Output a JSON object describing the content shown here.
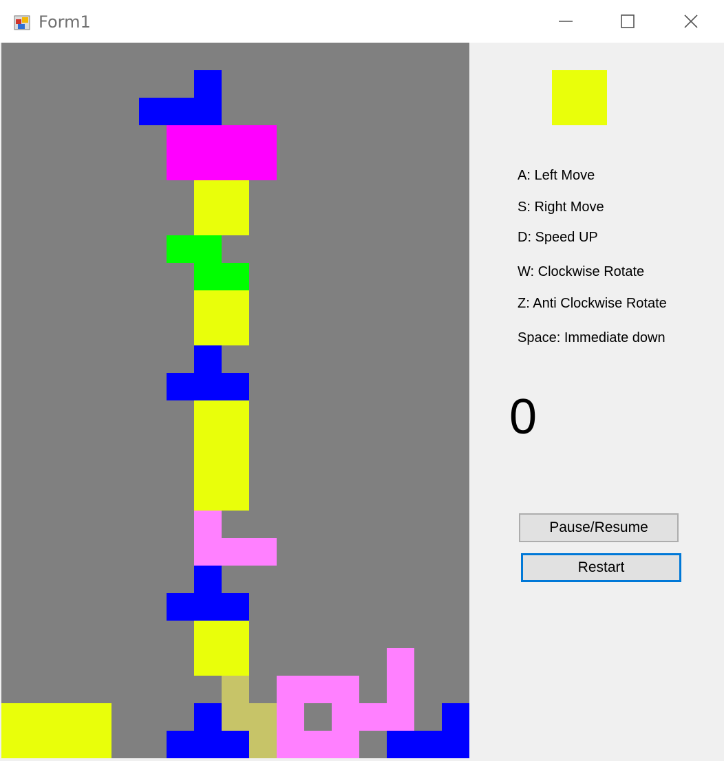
{
  "window": {
    "title": "Form1"
  },
  "colors": {
    "board_background": "#808080",
    "yellow": "#e9ff0a",
    "blue": "#0000ff",
    "magenta": "#ff00ff",
    "green": "#00ff00",
    "pink": "#ff80ff",
    "khaki": "#c7c468"
  },
  "board": {
    "columns": 17,
    "rows": 26,
    "cells": [
      {
        "col": 7,
        "row": 1,
        "color": "blue"
      },
      {
        "col": 5,
        "row": 2,
        "color": "blue"
      },
      {
        "col": 6,
        "row": 2,
        "color": "blue"
      },
      {
        "col": 7,
        "row": 2,
        "color": "blue"
      },
      {
        "col": 6,
        "row": 3,
        "color": "magenta"
      },
      {
        "col": 7,
        "row": 3,
        "color": "magenta"
      },
      {
        "col": 8,
        "row": 3,
        "color": "magenta"
      },
      {
        "col": 9,
        "row": 3,
        "color": "magenta"
      },
      {
        "col": 6,
        "row": 4,
        "color": "magenta"
      },
      {
        "col": 7,
        "row": 4,
        "color": "magenta"
      },
      {
        "col": 8,
        "row": 4,
        "color": "magenta"
      },
      {
        "col": 9,
        "row": 4,
        "color": "magenta"
      },
      {
        "col": 7,
        "row": 5,
        "color": "yellow"
      },
      {
        "col": 8,
        "row": 5,
        "color": "yellow"
      },
      {
        "col": 7,
        "row": 6,
        "color": "yellow"
      },
      {
        "col": 8,
        "row": 6,
        "color": "yellow"
      },
      {
        "col": 6,
        "row": 7,
        "color": "green"
      },
      {
        "col": 7,
        "row": 7,
        "color": "green"
      },
      {
        "col": 7,
        "row": 8,
        "color": "green"
      },
      {
        "col": 8,
        "row": 8,
        "color": "green"
      },
      {
        "col": 7,
        "row": 9,
        "color": "yellow"
      },
      {
        "col": 8,
        "row": 9,
        "color": "yellow"
      },
      {
        "col": 7,
        "row": 10,
        "color": "yellow"
      },
      {
        "col": 8,
        "row": 10,
        "color": "yellow"
      },
      {
        "col": 7,
        "row": 11,
        "color": "blue"
      },
      {
        "col": 6,
        "row": 12,
        "color": "blue"
      },
      {
        "col": 7,
        "row": 12,
        "color": "blue"
      },
      {
        "col": 8,
        "row": 12,
        "color": "blue"
      },
      {
        "col": 7,
        "row": 13,
        "color": "yellow"
      },
      {
        "col": 8,
        "row": 13,
        "color": "yellow"
      },
      {
        "col": 7,
        "row": 14,
        "color": "yellow"
      },
      {
        "col": 8,
        "row": 14,
        "color": "yellow"
      },
      {
        "col": 7,
        "row": 15,
        "color": "yellow"
      },
      {
        "col": 8,
        "row": 15,
        "color": "yellow"
      },
      {
        "col": 7,
        "row": 16,
        "color": "yellow"
      },
      {
        "col": 8,
        "row": 16,
        "color": "yellow"
      },
      {
        "col": 7,
        "row": 17,
        "color": "pink"
      },
      {
        "col": 7,
        "row": 18,
        "color": "pink"
      },
      {
        "col": 8,
        "row": 18,
        "color": "pink"
      },
      {
        "col": 9,
        "row": 18,
        "color": "pink"
      },
      {
        "col": 7,
        "row": 19,
        "color": "blue"
      },
      {
        "col": 6,
        "row": 20,
        "color": "blue"
      },
      {
        "col": 7,
        "row": 20,
        "color": "blue"
      },
      {
        "col": 8,
        "row": 20,
        "color": "blue"
      },
      {
        "col": 7,
        "row": 21,
        "color": "yellow"
      },
      {
        "col": 8,
        "row": 21,
        "color": "yellow"
      },
      {
        "col": 7,
        "row": 22,
        "color": "yellow"
      },
      {
        "col": 8,
        "row": 22,
        "color": "yellow"
      },
      {
        "col": 14,
        "row": 22,
        "color": "pink"
      },
      {
        "col": 8,
        "row": 23,
        "color": "khaki"
      },
      {
        "col": 10,
        "row": 23,
        "color": "pink"
      },
      {
        "col": 11,
        "row": 23,
        "color": "pink"
      },
      {
        "col": 12,
        "row": 23,
        "color": "pink"
      },
      {
        "col": 14,
        "row": 23,
        "color": "pink"
      },
      {
        "col": 0,
        "row": 24,
        "color": "yellow"
      },
      {
        "col": 1,
        "row": 24,
        "color": "yellow"
      },
      {
        "col": 2,
        "row": 24,
        "color": "yellow"
      },
      {
        "col": 3,
        "row": 24,
        "color": "yellow"
      },
      {
        "col": 7,
        "row": 24,
        "color": "blue"
      },
      {
        "col": 8,
        "row": 24,
        "color": "khaki"
      },
      {
        "col": 9,
        "row": 24,
        "color": "khaki"
      },
      {
        "col": 10,
        "row": 24,
        "color": "pink"
      },
      {
        "col": 12,
        "row": 24,
        "color": "pink"
      },
      {
        "col": 13,
        "row": 24,
        "color": "pink"
      },
      {
        "col": 14,
        "row": 24,
        "color": "pink"
      },
      {
        "col": 16,
        "row": 24,
        "color": "blue"
      },
      {
        "col": 0,
        "row": 25,
        "color": "yellow"
      },
      {
        "col": 1,
        "row": 25,
        "color": "yellow"
      },
      {
        "col": 2,
        "row": 25,
        "color": "yellow"
      },
      {
        "col": 3,
        "row": 25,
        "color": "yellow"
      },
      {
        "col": 6,
        "row": 25,
        "color": "blue"
      },
      {
        "col": 7,
        "row": 25,
        "color": "blue"
      },
      {
        "col": 8,
        "row": 25,
        "color": "blue"
      },
      {
        "col": 9,
        "row": 25,
        "color": "khaki"
      },
      {
        "col": 10,
        "row": 25,
        "color": "pink"
      },
      {
        "col": 11,
        "row": 25,
        "color": "pink"
      },
      {
        "col": 12,
        "row": 25,
        "color": "pink"
      },
      {
        "col": 14,
        "row": 25,
        "color": "blue"
      },
      {
        "col": 15,
        "row": 25,
        "color": "blue"
      },
      {
        "col": 16,
        "row": 25,
        "color": "blue"
      }
    ]
  },
  "next_piece": {
    "color": "yellow"
  },
  "controls": {
    "left": "A: Left Move",
    "right": "S: Right Move",
    "speed": "D: Speed UP",
    "cw": "W: Clockwise Rotate",
    "acw": "Z: Anti Clockwise Rotate",
    "drop": "Space: Immediate down"
  },
  "score": "0",
  "buttons": {
    "pause": "Pause/Resume",
    "restart": "Restart"
  }
}
